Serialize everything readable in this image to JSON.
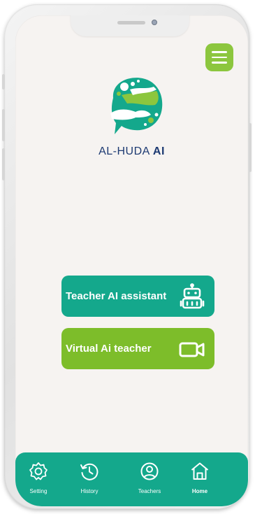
{
  "brand": {
    "name_main": "AL-HUDA ",
    "name_accent": "AI"
  },
  "actions": [
    {
      "label": "Teacher AI assistant",
      "icon": "robot-icon"
    },
    {
      "label": "Virtual Ai teacher",
      "icon": "video-camera-icon"
    }
  ],
  "nav": [
    {
      "label": "Setting",
      "icon": "gear-icon",
      "active": false
    },
    {
      "label": "History",
      "icon": "history-icon",
      "active": false
    },
    {
      "label": "Teachers",
      "icon": "user-circle-icon",
      "active": false
    },
    {
      "label": "Home",
      "icon": "home-icon",
      "active": true
    }
  ],
  "colors": {
    "teal": "#14a88c",
    "green": "#7dbd2a",
    "menu_green": "#8cc63e",
    "brand_blue": "#1d3a72",
    "background": "#f6f3f1"
  }
}
